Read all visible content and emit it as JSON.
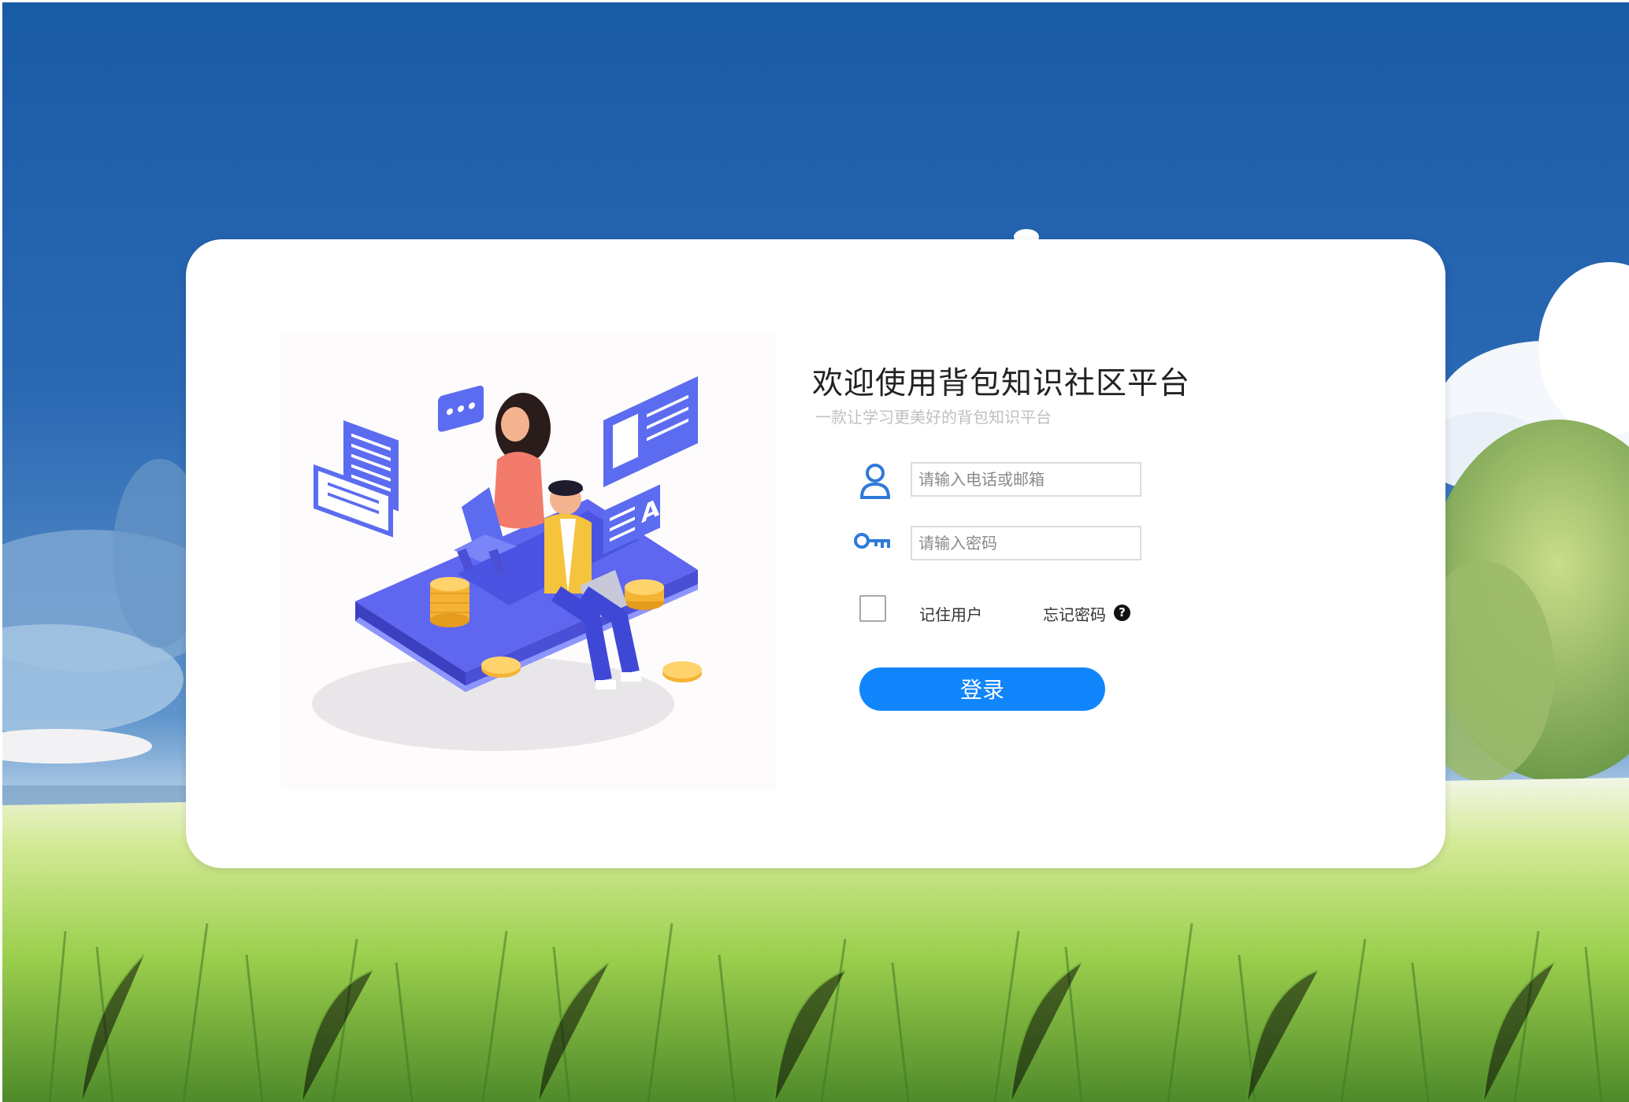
{
  "login": {
    "title": "欢迎使用背包知识社区平台",
    "subtitle": "一款让学习更美好的背包知识平台",
    "username_placeholder": "请输入电话或邮箱",
    "password_placeholder": "请输入密码",
    "remember_label": "记住用户",
    "forgot_label": "忘记密码",
    "help_glyph": "?",
    "login_button": "登录",
    "remember_checked": false
  },
  "icons": {
    "user": "user-icon",
    "password": "key-icon",
    "help": "question-circle-icon"
  },
  "colors": {
    "primary": "#1085fc",
    "sky": "#1e5fa6",
    "grass": "#8cc63f",
    "card": "#ffffff",
    "title_text": "#222222",
    "subtitle_text": "#c0c0c0"
  }
}
